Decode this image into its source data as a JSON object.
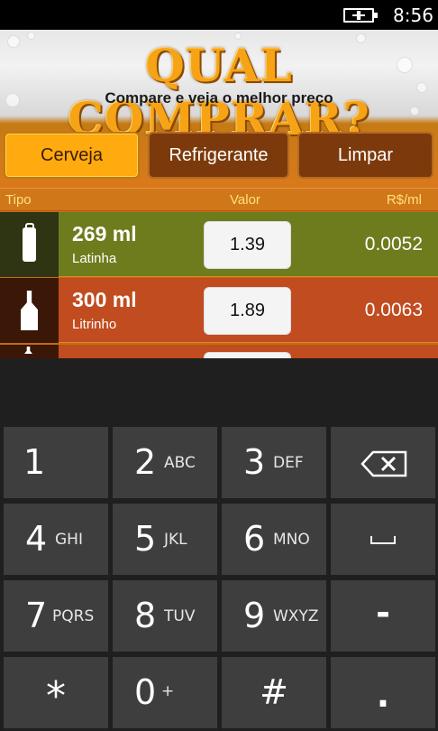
{
  "status_bar": {
    "battery_icon": "battery-charging-icon",
    "time": "8:56"
  },
  "header": {
    "title": "QUAL COMPRAR?",
    "subtitle": "Compare e veja o melhor preço"
  },
  "buttons": {
    "cerveja": "Cerveja",
    "refrigerante": "Refrigerante",
    "limpar": "Limpar"
  },
  "columns": {
    "tipo": "Tipo",
    "valor": "Valor",
    "rs_ml": "R$/ml"
  },
  "rows": [
    {
      "icon": "can-icon",
      "size": "269 ml",
      "name": "Latinha",
      "price": "1.39",
      "ratio": "0.0052",
      "color": "#6f7c1e"
    },
    {
      "icon": "bottle-icon",
      "size": "300 ml",
      "name": "Litrinho",
      "price": "1.89",
      "ratio": "0.0063",
      "color": "#c04c20"
    },
    {
      "icon": "bottle-icon",
      "size": "",
      "name": "",
      "price": "",
      "ratio": "",
      "color": "#c04c20"
    }
  ],
  "keyboard": {
    "keys": [
      {
        "digit": "1",
        "letters": ""
      },
      {
        "digit": "2",
        "letters": "ABC"
      },
      {
        "digit": "3",
        "letters": "DEF"
      },
      {
        "icon": "backspace-icon"
      },
      {
        "digit": "4",
        "letters": "GHI"
      },
      {
        "digit": "5",
        "letters": "JKL"
      },
      {
        "digit": "6",
        "letters": "MNO"
      },
      {
        "icon": "space-icon"
      },
      {
        "digit": "7",
        "letters": "PQRS"
      },
      {
        "digit": "8",
        "letters": "TUV"
      },
      {
        "digit": "9",
        "letters": "WXYZ"
      },
      {
        "digit": "-",
        "letters": ""
      },
      {
        "digit": "*",
        "letters": ""
      },
      {
        "digit": "0",
        "letters": "+"
      },
      {
        "digit": "#",
        "letters": ""
      },
      {
        "digit": ".",
        "letters": ""
      }
    ]
  },
  "colors": {
    "accent_button": "#ffaa0f",
    "dark_button": "#7c3a0c",
    "keyboard_key": "#3e3e3e",
    "keyboard_bg": "#1f1f1f"
  }
}
